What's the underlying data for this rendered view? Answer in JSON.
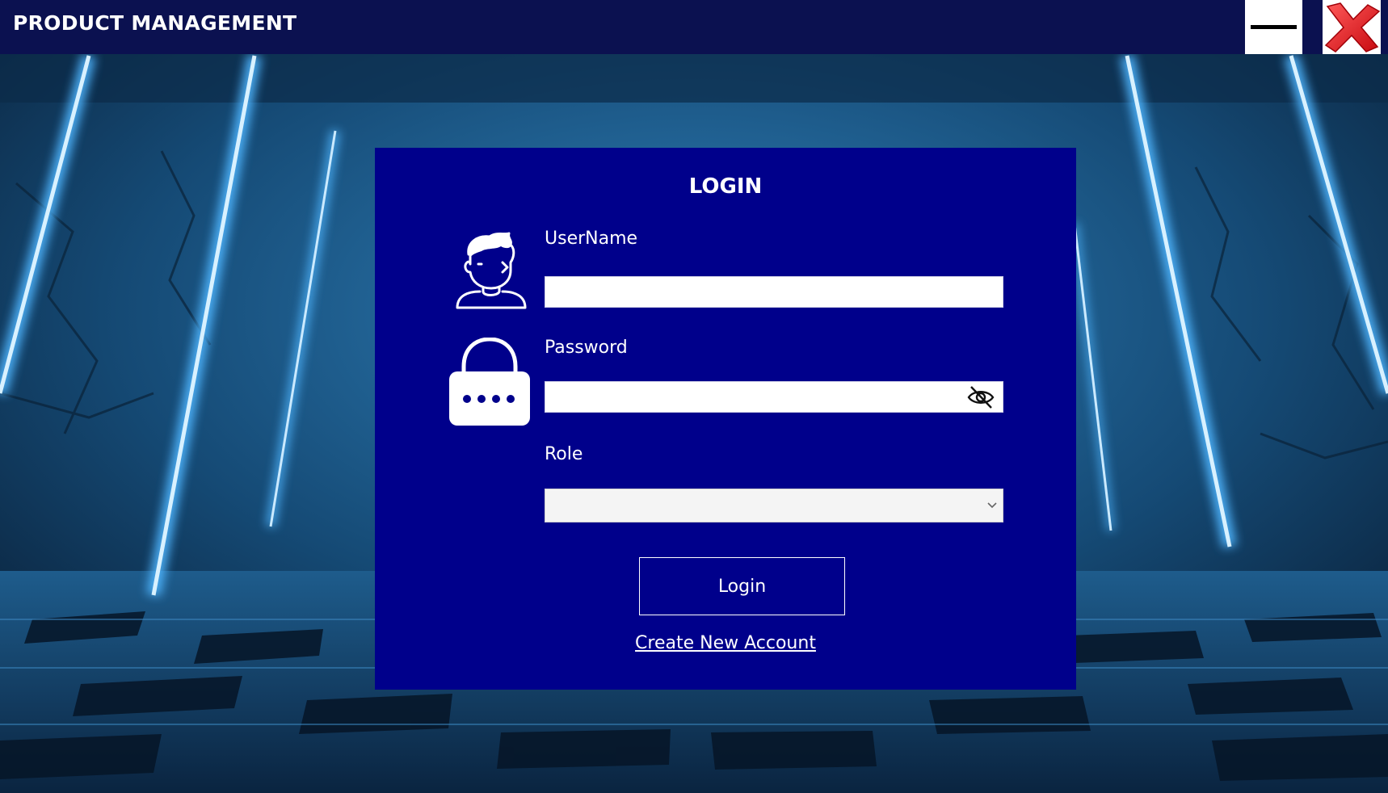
{
  "window": {
    "title": "PRODUCT MANAGEMENT",
    "controls": {
      "minimize_icon": "minimize-icon",
      "close_icon": "close-x-icon"
    }
  },
  "login": {
    "heading": "LOGIN",
    "username": {
      "label": "UserName",
      "value": "",
      "icon": "user-avatar-icon"
    },
    "password": {
      "label": "Password",
      "value": "",
      "icon": "padlock-icon",
      "toggle_icon": "eye-slash-icon"
    },
    "role": {
      "label": "Role",
      "selected": ""
    },
    "submit_label": "Login",
    "create_account_label": "Create New Account"
  },
  "colors": {
    "titlebar": "#0b1150",
    "panel": "#00008b",
    "close_red": "#e4141c",
    "neon": "#4fb6ff"
  }
}
